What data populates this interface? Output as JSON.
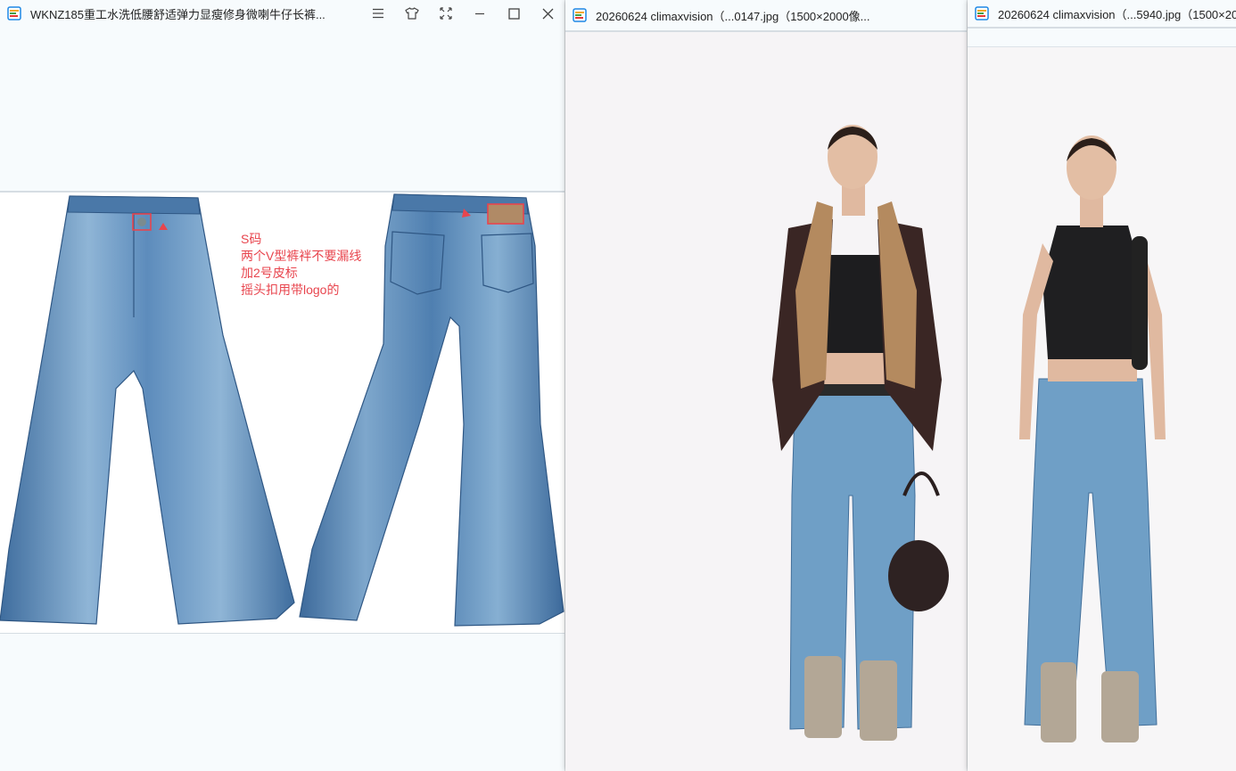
{
  "windows": [
    {
      "title": "WKNZ185重工水洗低腰舒适弹力显瘦修身微喇牛仔长裤...",
      "controls": [
        "menu-icon",
        "tshirt-icon",
        "fit-icon",
        "minimize-icon",
        "maximize-icon",
        "close-icon"
      ],
      "annotation": {
        "lines": [
          "S码",
          "两个V型裤袢不要漏线",
          "加2号皮标",
          "摇头扣用带logo的"
        ]
      }
    },
    {
      "title": "20260624 climaxvision（...0147.jpg（1500×2000像..."
    },
    {
      "title": "20260624 climaxvision（...5940.jpg（1500×20..."
    }
  ],
  "colors": {
    "annotation": "#e8454e",
    "denim": "#4f7fb0",
    "denim_light": "#9cc0dc",
    "background": "#f7fbfd"
  }
}
